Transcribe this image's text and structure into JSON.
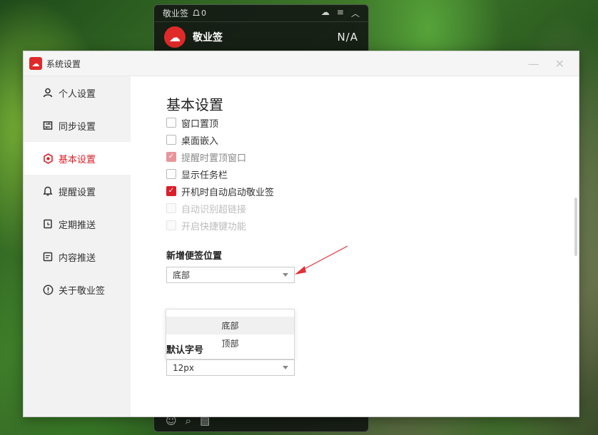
{
  "mini": {
    "title": "敬业签",
    "bell_count": "0",
    "app_name": "敬业签",
    "value": "N/A"
  },
  "window": {
    "title": "系统设置"
  },
  "sidebar": {
    "items": [
      {
        "label": "个人设置",
        "icon": "user-icon"
      },
      {
        "label": "同步设置",
        "icon": "sync-icon"
      },
      {
        "label": "基本设置",
        "icon": "settings-icon",
        "active": true
      },
      {
        "label": "提醒设置",
        "icon": "bell-icon"
      },
      {
        "label": "定期推送",
        "icon": "calendar-icon"
      },
      {
        "label": "内容推送",
        "icon": "document-icon"
      },
      {
        "label": "关于敬业签",
        "icon": "info-icon"
      }
    ]
  },
  "main": {
    "section_title": "基本设置",
    "options": [
      {
        "label": "窗口置顶",
        "state": "unchecked"
      },
      {
        "label": "桌面嵌入",
        "state": "unchecked"
      },
      {
        "label": "提醒时置顶窗口",
        "state": "checked-disabled"
      },
      {
        "label": "显示任务栏",
        "state": "unchecked"
      },
      {
        "label": "开机时自动启动敬业签",
        "state": "checked"
      },
      {
        "label": "自动识别超链接",
        "state": "disabled"
      },
      {
        "label": "开启快捷键功能",
        "state": "disabled"
      }
    ],
    "position_label": "新增便签位置",
    "position_value": "底部",
    "position_options": [
      "底部",
      "顶部"
    ],
    "font_label": "默认字号",
    "font_value": "12px"
  },
  "colors": {
    "accent": "#d9202a"
  }
}
